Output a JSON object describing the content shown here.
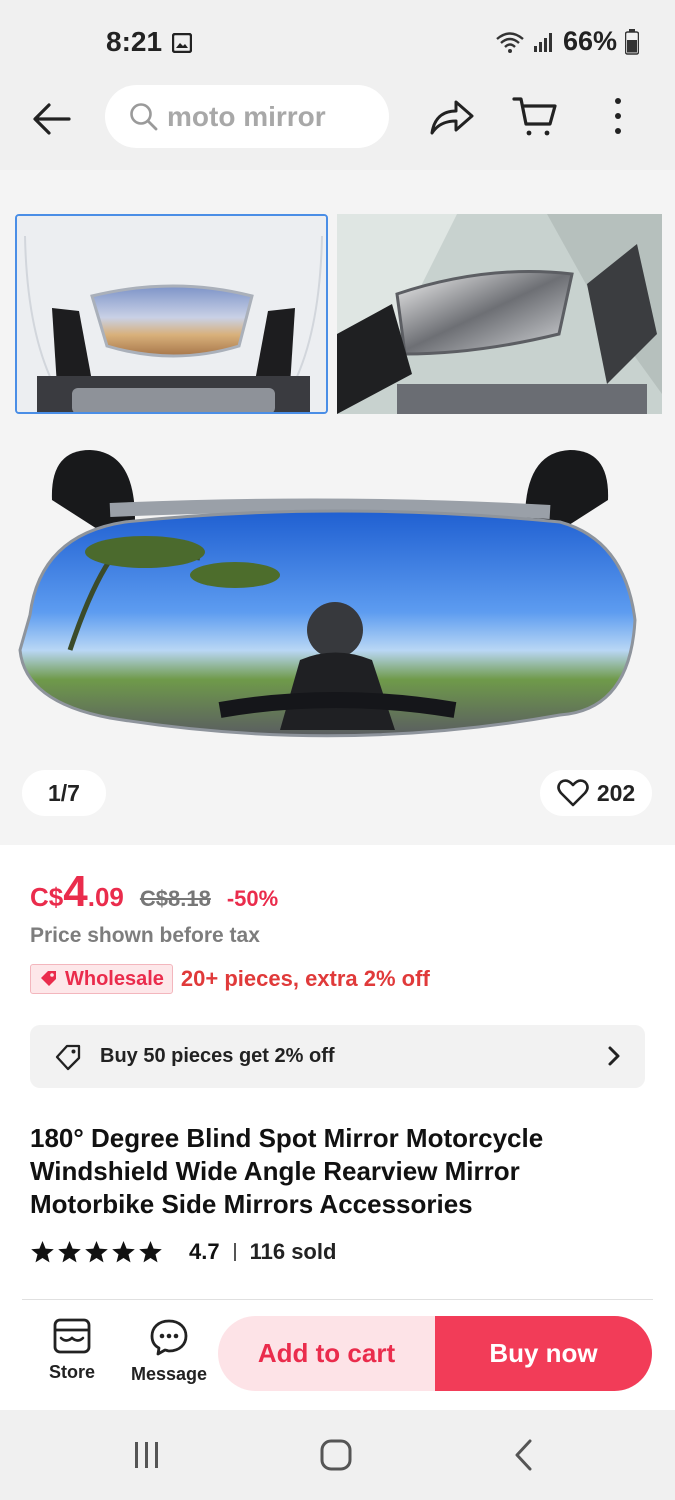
{
  "status_bar": {
    "time": "8:21",
    "battery": "66%",
    "icons": [
      "gallery-icon",
      "wifi-icon",
      "signal-icon",
      "battery-icon"
    ]
  },
  "top_bar": {
    "search_text": "moto mirror",
    "icons": [
      "back-arrow-icon",
      "search-icon",
      "share-icon",
      "cart-icon",
      "more-vertical-icon"
    ]
  },
  "gallery": {
    "counter": "1/7",
    "likes": "202"
  },
  "price": {
    "currency": "C$",
    "integer": "4",
    "decimal": ".09",
    "original": "C$8.18",
    "discount": "-50%",
    "tax_note": "Price shown before tax"
  },
  "wholesale": {
    "badge": "Wholesale",
    "text": "20+ pieces, extra 2% off"
  },
  "coupon": {
    "label": "Buy 50 pieces get 2% off"
  },
  "product": {
    "title": "180° Degree Blind Spot Mirror Motorcycle Windshield Wide Angle Rearview Mirror Motorbike Side Mirrors Accessories",
    "rating": "4.7",
    "stars": 5,
    "sold": "116 sold"
  },
  "actions": {
    "store": "Store",
    "message": "Message",
    "add_to_cart": "Add to cart",
    "buy_now": "Buy now"
  },
  "colors": {
    "accent": "#ea2c4c",
    "buy_now_bg": "#f23c58",
    "add_to_cart_bg": "#fde3e7",
    "chrome_bg": "#f0f0f0"
  }
}
